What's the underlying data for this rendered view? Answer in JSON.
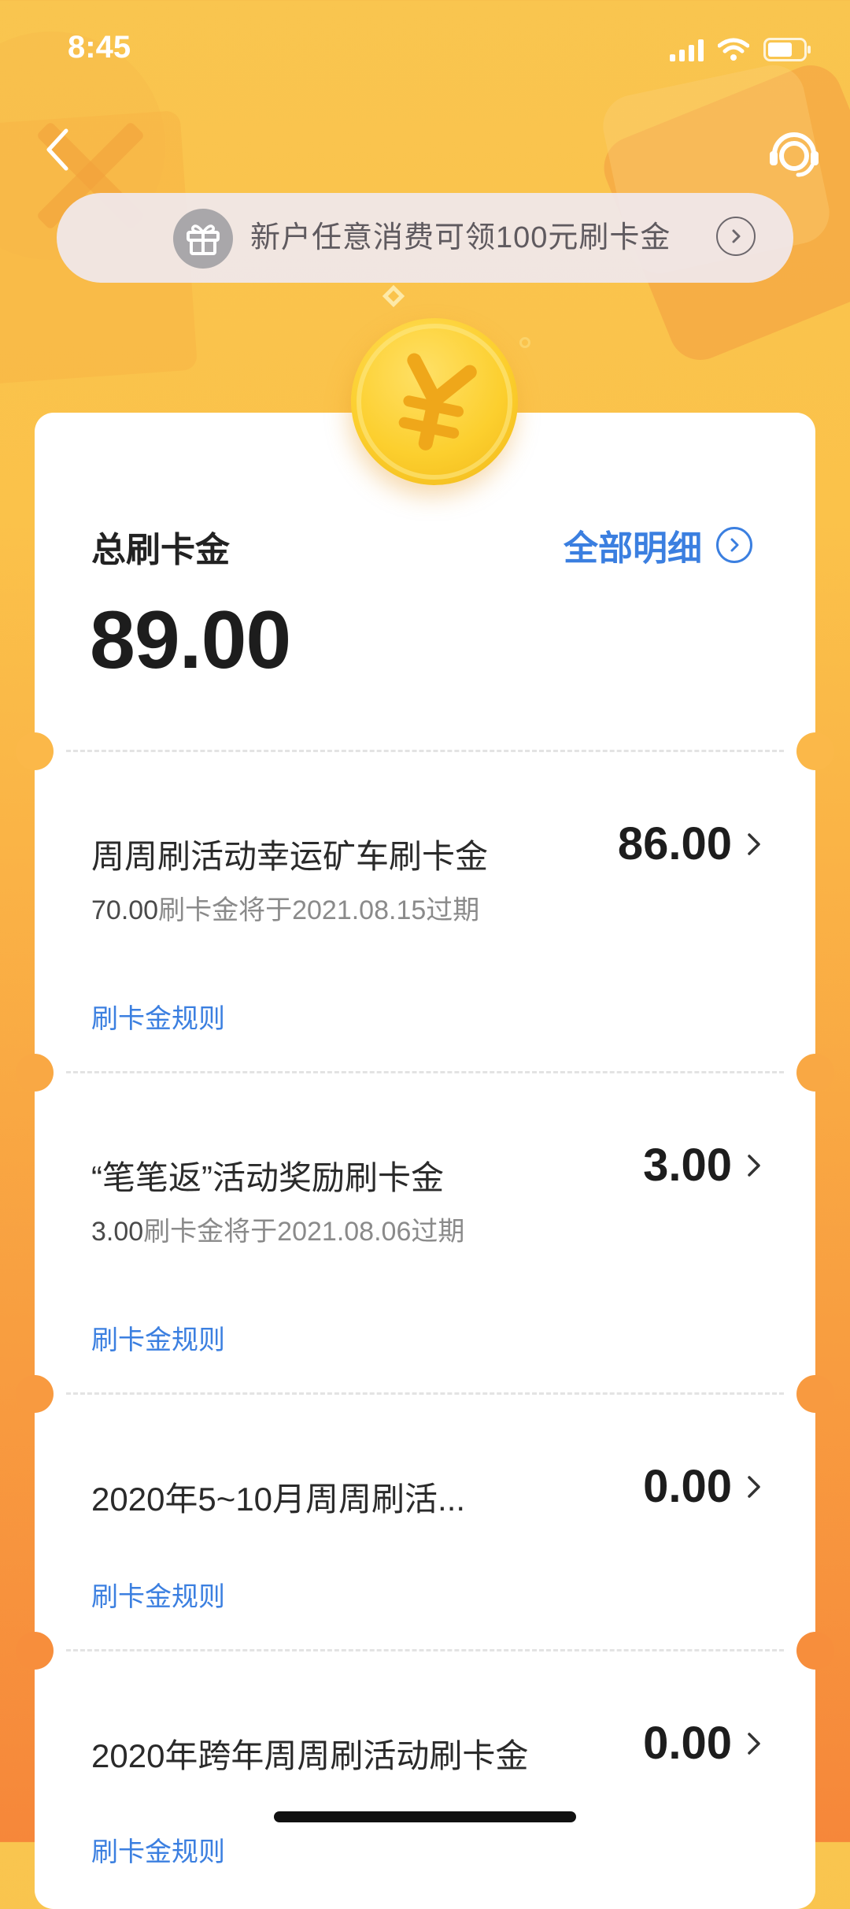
{
  "status_bar": {
    "time": "8:45"
  },
  "promo": {
    "text": "新户任意消费可领100元刷卡金"
  },
  "summary": {
    "label": "总刷卡金",
    "total": "89.00",
    "all_details_label": "全部明细"
  },
  "items": [
    {
      "title": "周周刷活动幸运矿车刷卡金",
      "amount": "86.00",
      "expiry_amount": "70.00",
      "expiry_text": "刷卡金将于2021.08.15过期",
      "rules": "刷卡金规则"
    },
    {
      "title": "“笔笔返”活动奖励刷卡金",
      "amount": "3.00",
      "expiry_amount": "3.00",
      "expiry_text": "刷卡金将于2021.08.06过期",
      "rules": "刷卡金规则"
    },
    {
      "title": "2020年5~10月周周刷活...",
      "amount": "0.00",
      "rules": "刷卡金规则"
    },
    {
      "title": "2020年跨年周周刷活动刷卡金",
      "amount": "0.00",
      "rules": "刷卡金规则"
    }
  ],
  "colors": {
    "accent": "#3b7fe0",
    "background_top": "#f9c54f",
    "background_bottom": "#f6873a"
  }
}
